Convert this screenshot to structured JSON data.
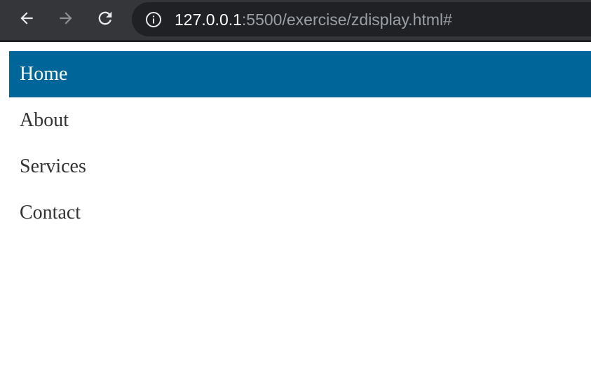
{
  "browser": {
    "url_host": "127.0.0.1",
    "url_path": ":5500/exercise/zdisplay.html#",
    "icons": {
      "back": "arrow-left-icon",
      "forward": "arrow-right-icon",
      "reload": "reload-icon",
      "site_info": "info-icon"
    }
  },
  "menu": {
    "items": [
      {
        "label": "Home",
        "active": true
      },
      {
        "label": "About"
      },
      {
        "label": "Services"
      },
      {
        "label": "Contact"
      }
    ],
    "active_color": "#006699"
  }
}
